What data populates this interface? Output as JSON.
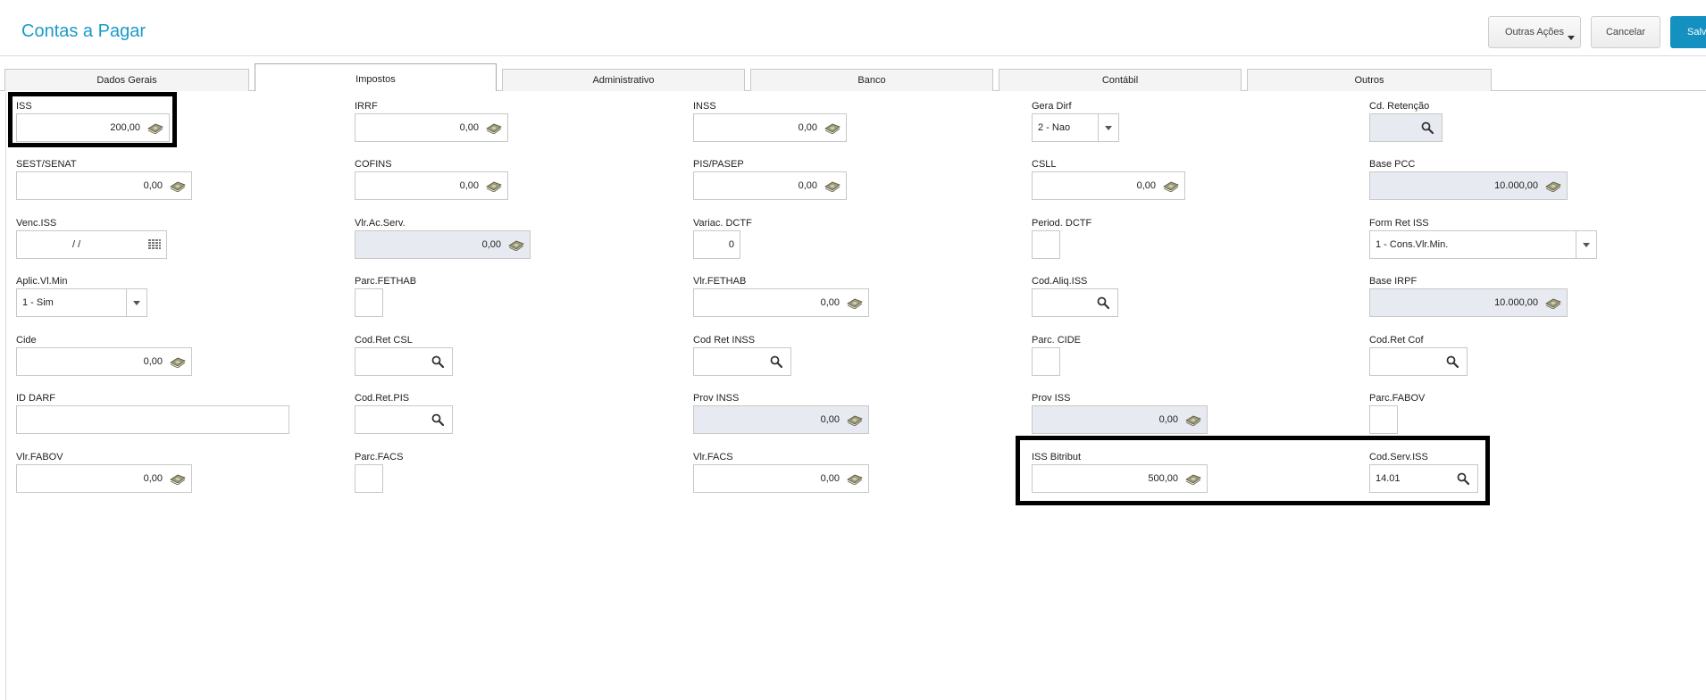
{
  "header": {
    "title": "Contas a Pagar",
    "outras_acoes": "Outras Ações",
    "cancelar": "Cancelar",
    "salvar": "Salv"
  },
  "tabs": [
    "Dados Gerais",
    "Impostos",
    "Administrativo",
    "Banco",
    "Contábil",
    "Outros"
  ],
  "fields": {
    "iss": {
      "label": "ISS",
      "value": "200,00"
    },
    "irrf": {
      "label": "IRRF",
      "value": "0,00"
    },
    "inss": {
      "label": "INSS",
      "value": "0,00"
    },
    "gera_dirf": {
      "label": "Gera Dirf",
      "value": "2 - Nao"
    },
    "cd_retencao": {
      "label": "Cd. Retenção",
      "value": ""
    },
    "sest_senat": {
      "label": "SEST/SENAT",
      "value": "0,00"
    },
    "cofins": {
      "label": "COFINS",
      "value": "0,00"
    },
    "pis_pasep": {
      "label": "PIS/PASEP",
      "value": "0,00"
    },
    "csll": {
      "label": "CSLL",
      "value": "0,00"
    },
    "base_pcc": {
      "label": "Base PCC",
      "value": "10.000,00"
    },
    "venc_iss": {
      "label": "Venc.ISS",
      "value": "/ /"
    },
    "vlr_ac_serv": {
      "label": "Vlr.Ac.Serv.",
      "value": "0,00"
    },
    "variac_dctf": {
      "label": "Variac. DCTF",
      "value": "0"
    },
    "period_dctf": {
      "label": "Period. DCTF",
      "value": ""
    },
    "form_ret_iss": {
      "label": "Form Ret ISS",
      "value": "1 - Cons.Vlr.Min."
    },
    "aplic_vl_min": {
      "label": "Aplic.Vl.Min",
      "value": "1 - Sim"
    },
    "parc_fethab": {
      "label": "Parc.FETHAB",
      "value": ""
    },
    "vlr_fethab": {
      "label": "Vlr.FETHAB",
      "value": "0,00"
    },
    "cod_aliq_iss": {
      "label": "Cod.Aliq.ISS",
      "value": ""
    },
    "base_irpf": {
      "label": "Base IRPF",
      "value": "10.000,00"
    },
    "cide": {
      "label": "Cide",
      "value": "0,00"
    },
    "cod_ret_csl": {
      "label": "Cod.Ret CSL",
      "value": ""
    },
    "cod_ret_inss": {
      "label": "Cod Ret INSS",
      "value": ""
    },
    "parc_cide": {
      "label": "Parc. CIDE",
      "value": ""
    },
    "cod_ret_cof": {
      "label": "Cod.Ret Cof",
      "value": ""
    },
    "id_darf": {
      "label": "ID DARF",
      "value": ""
    },
    "cod_ret_pis": {
      "label": "Cod.Ret.PIS",
      "value": ""
    },
    "prov_inss": {
      "label": "Prov INSS",
      "value": "0,00"
    },
    "prov_iss": {
      "label": "Prov ISS",
      "value": "0,00"
    },
    "parc_fabov": {
      "label": "Parc.FABOV",
      "value": ""
    },
    "vlr_fabov": {
      "label": "Vlr.FABOV",
      "value": "0,00"
    },
    "parc_facs": {
      "label": "Parc.FACS",
      "value": ""
    },
    "vlr_facs": {
      "label": "Vlr.FACS",
      "value": "0,00"
    },
    "iss_bitribut": {
      "label": "ISS Bitribut",
      "value": "500,00"
    },
    "cod_serv_iss": {
      "label": "Cod.Serv.ISS",
      "value": "14.01"
    }
  },
  "icons": {
    "money": "money-icon",
    "search": "search-icon",
    "calendar": "calendar-icon",
    "dropdown": "chevron-down-icon"
  },
  "colors": {
    "title": "#1a9bc8",
    "primary_button": "#1591c1",
    "disabled_field": "#e7eaf0",
    "highlight": "#000000"
  }
}
